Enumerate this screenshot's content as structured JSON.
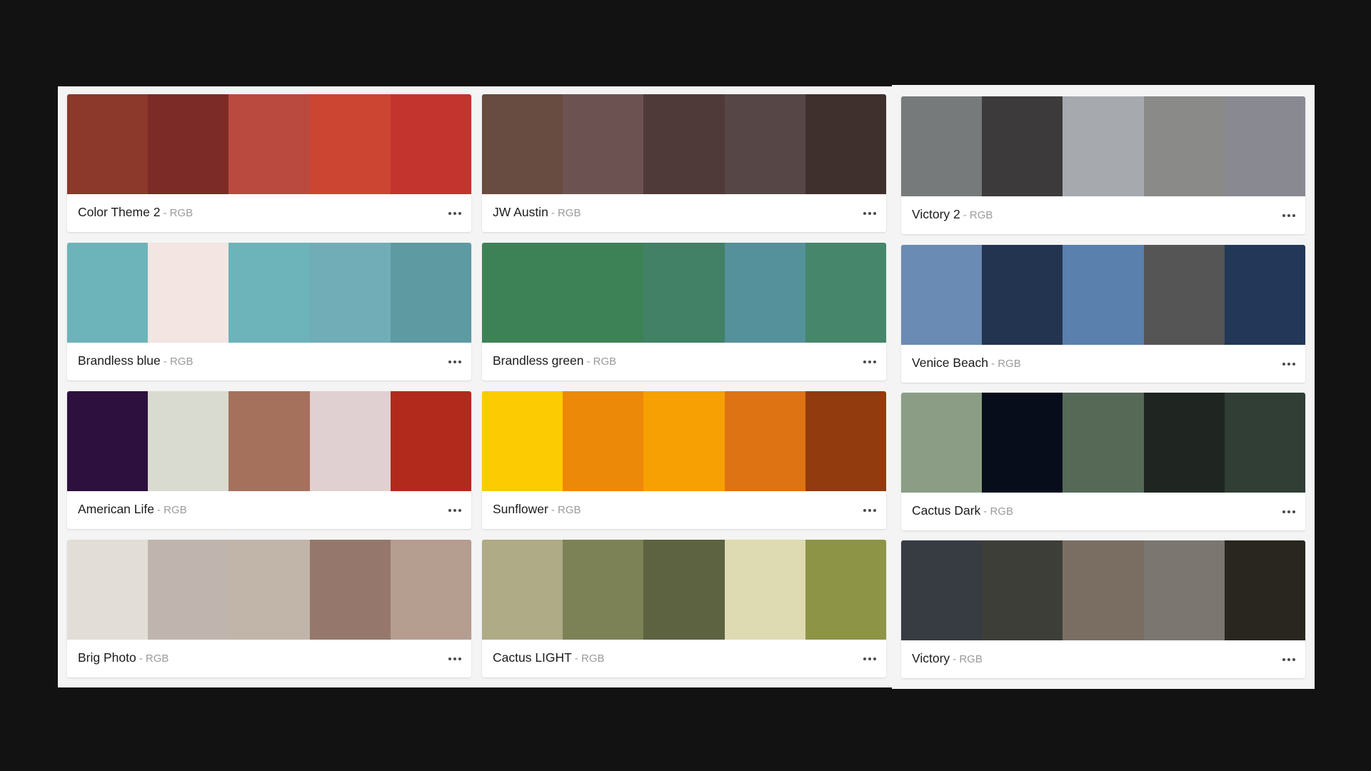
{
  "cards": [
    {
      "name": "Color Theme 2",
      "mode": "- RGB",
      "colors": [
        "#8C392B",
        "#7D2B27",
        "#BA4A3F",
        "#CC4533",
        "#C3342F"
      ]
    },
    {
      "name": "JW Austin",
      "mode": "- RGB",
      "colors": [
        "#684B41",
        "#6C5352",
        "#503A39",
        "#564646",
        "#3F2F2D"
      ]
    },
    {
      "name": "Victory 2",
      "mode": "- RGB",
      "colors": [
        "#777A7A",
        "#3C3A3A",
        "#A6AAAF",
        "#8A8A88",
        "#898991"
      ]
    },
    {
      "name": "Brandless blue",
      "mode": "- RGB",
      "colors": [
        "#6DB3BA",
        "#F3E5E2",
        "#6DB3BA",
        "#71ADB7",
        "#5D9AA2"
      ]
    },
    {
      "name": "Brandless green",
      "mode": "- RGB",
      "colors": [
        "#3D8256",
        "#3D8256",
        "#428166",
        "#55919A",
        "#46866A"
      ]
    },
    {
      "name": "Venice Beach",
      "mode": "- RGB",
      "colors": [
        "#6A8BB4",
        "#233450",
        "#5A80AD",
        "#555555",
        "#233858"
      ]
    },
    {
      "name": "American Life",
      "mode": "- RGB",
      "colors": [
        "#2E103E",
        "#D9DAD0",
        "#A5715D",
        "#E1D0D2",
        "#B12A1C"
      ]
    },
    {
      "name": "Sunflower",
      "mode": "- RGB",
      "colors": [
        "#FDCB02",
        "#EC8908",
        "#F6A003",
        "#DD7313",
        "#913B0E"
      ]
    },
    {
      "name": "Cactus Dark",
      "mode": "- RGB",
      "colors": [
        "#8B9E85",
        "#080D1C",
        "#566957",
        "#1F2621",
        "#303E36"
      ]
    },
    {
      "name": "Brig Photo",
      "mode": "- RGB",
      "colors": [
        "#E2DDD7",
        "#C0B5AE",
        "#C1B4A8",
        "#95786B",
        "#B59D90"
      ]
    },
    {
      "name": "Cactus LIGHT",
      "mode": "- RGB",
      "colors": [
        "#AFAB86",
        "#7D8256",
        "#5D6241",
        "#DEDAB1",
        "#8E9445"
      ]
    },
    {
      "name": "Victory",
      "mode": "- RGB",
      "colors": [
        "#373C43",
        "#3E3E39",
        "#7A6E63",
        "#7B7670",
        "#29261F"
      ]
    }
  ]
}
